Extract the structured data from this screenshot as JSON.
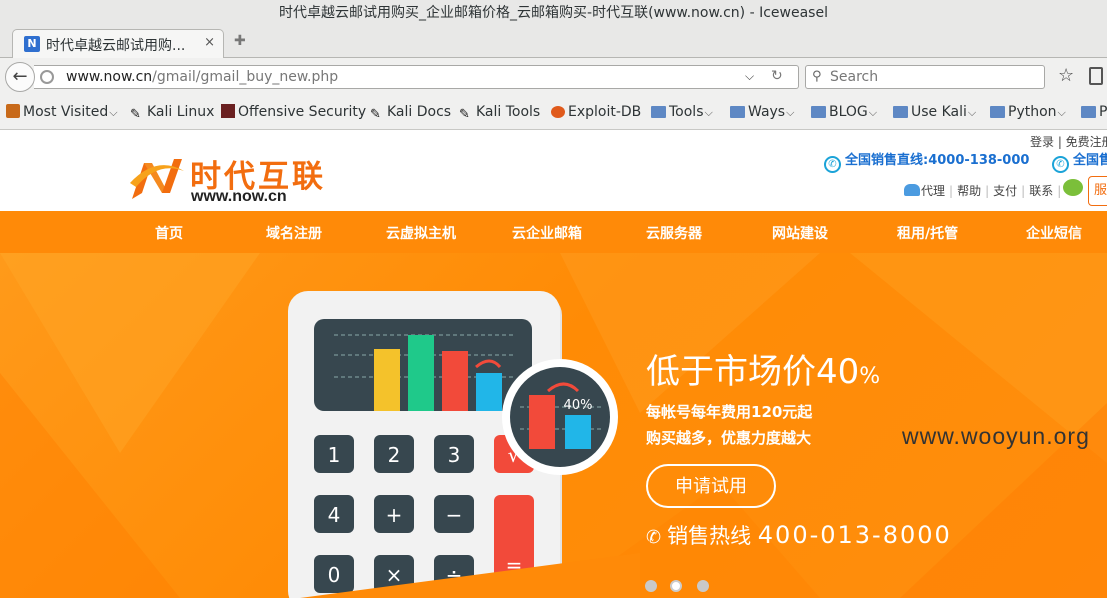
{
  "window": {
    "title": "时代卓越云邮试用购买_企业邮箱价格_云邮箱购买-时代互联(www.now.cn) - Iceweasel"
  },
  "tab": {
    "title": "时代卓越云邮试用购...",
    "close": "×",
    "new_tab": "✚"
  },
  "navbar": {
    "url_host": "www.now.cn",
    "url_path": "/gmail/gmail_buy_new.php",
    "search_placeholder": "Search"
  },
  "bookmarks": [
    {
      "label": "Most Visited",
      "icon": "most-visited-icon",
      "chevron": "⌵"
    },
    {
      "label": "Kali Linux",
      "icon": "kali-dragon-icon"
    },
    {
      "label": "Offensive Security",
      "icon": "offsec-icon"
    },
    {
      "label": "Kali Docs",
      "icon": "kali-dragon-icon"
    },
    {
      "label": "Kali Tools",
      "icon": "kali-dragon-icon"
    },
    {
      "label": "Exploit-DB",
      "icon": "exploit-db-icon"
    },
    {
      "label": "Tools",
      "icon": "folder-icon",
      "chevron": "⌵"
    },
    {
      "label": "Ways",
      "icon": "folder-icon",
      "chevron": "⌵"
    },
    {
      "label": "BLOG",
      "icon": "folder-icon",
      "chevron": "⌵"
    },
    {
      "label": "Use Kali",
      "icon": "folder-icon",
      "chevron": "⌵"
    },
    {
      "label": "Python",
      "icon": "folder-icon",
      "chevron": "⌵"
    },
    {
      "label": "P",
      "icon": "folder-icon"
    }
  ],
  "site": {
    "logo_cn": "时代互联",
    "logo_en": "www.now.cn",
    "top_links": "登录 | 免费注册",
    "hotline1": "全国销售直线:4000-138-000",
    "hotline2": "全国售",
    "sub_links": [
      "代理",
      "帮助",
      "支付",
      "联系"
    ],
    "service_btn": "服",
    "nav": [
      "首页",
      "域名注册",
      "云虚拟主机",
      "云企业邮箱",
      "云服务器",
      "网站建设",
      "租用/托管",
      "企业短信"
    ],
    "banner": {
      "headline": "低于市场价40",
      "headline_pct": "%",
      "line1": "每帐号每年费用120元起",
      "line2": "购买越多，优惠力度越大",
      "button": "申请试用",
      "hotline_label": "销售热线",
      "hotline_number": "400-013-8000",
      "badge": "40%",
      "calc_keys": [
        "1",
        "2",
        "3",
        "√",
        "4",
        "+",
        "−",
        "0",
        "×",
        "÷",
        "="
      ]
    },
    "slides": 3,
    "active_slide": 2
  },
  "watermark": "www.wooyun.org"
}
